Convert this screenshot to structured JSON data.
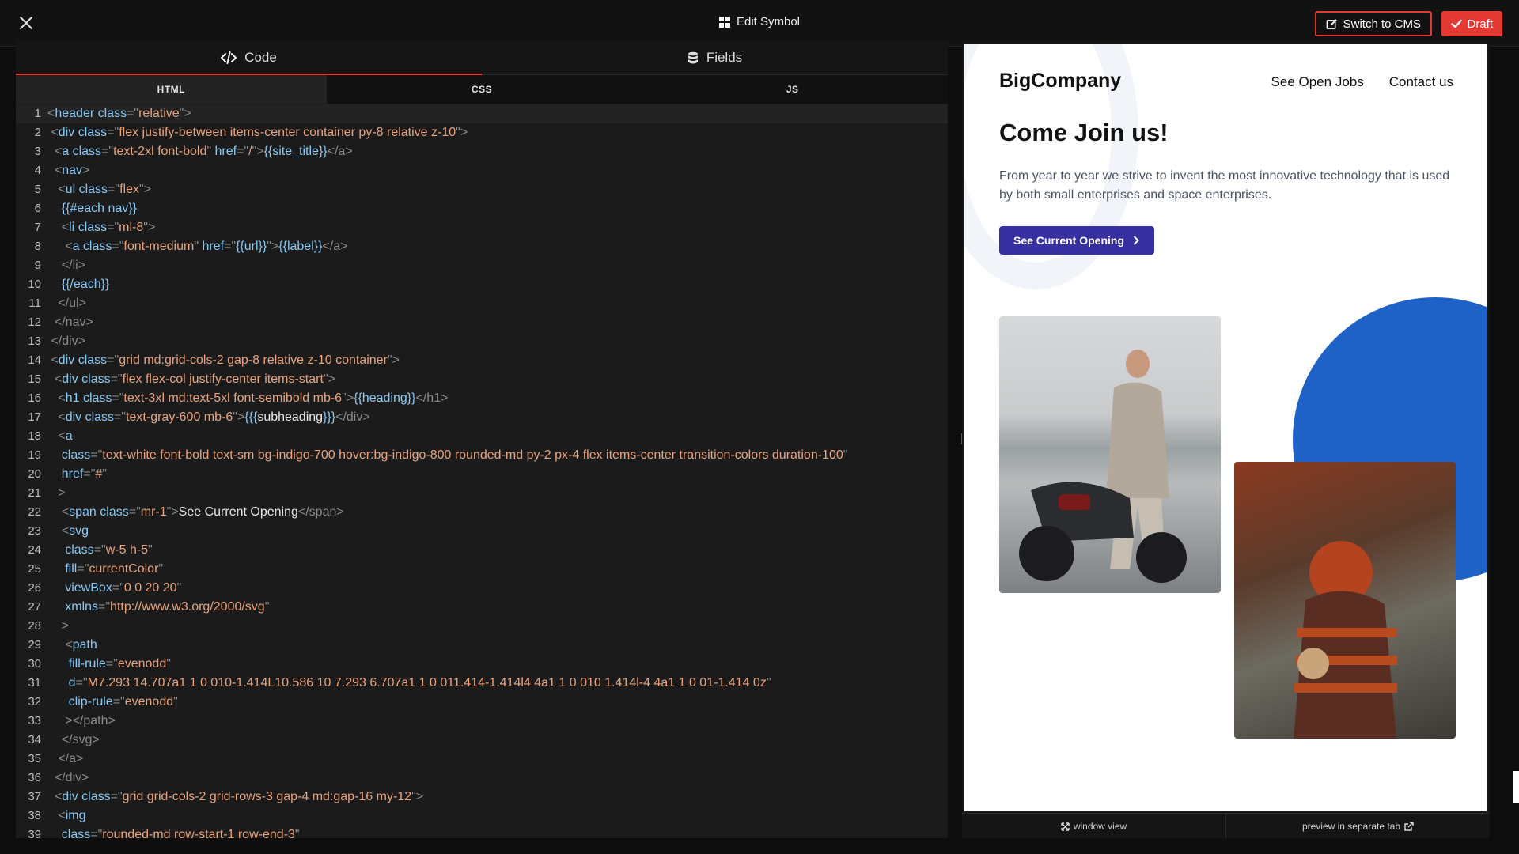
{
  "topbar": {
    "title": "Edit Symbol",
    "switch_label": "Switch to CMS",
    "draft_label": "Draft"
  },
  "editor": {
    "tabs": [
      {
        "label": "Code"
      },
      {
        "label": "Fields"
      }
    ],
    "subtabs": [
      {
        "label": "HTML"
      },
      {
        "label": "CSS"
      },
      {
        "label": "JS"
      }
    ],
    "lines": [
      [
        [
          "p",
          "<"
        ],
        [
          "t",
          "header "
        ],
        [
          "a",
          "class"
        ],
        [
          "p",
          "=\""
        ],
        [
          "s",
          "relative"
        ],
        [
          "p",
          "\">"
        ]
      ],
      [
        [
          "p",
          " <"
        ],
        [
          "t",
          "div "
        ],
        [
          "a",
          "class"
        ],
        [
          "p",
          "=\""
        ],
        [
          "s",
          "flex justify-between items-center container py-8 relative z-10"
        ],
        [
          "p",
          "\">"
        ]
      ],
      [
        [
          "p",
          "  <"
        ],
        [
          "t",
          "a "
        ],
        [
          "a",
          "class"
        ],
        [
          "p",
          "=\""
        ],
        [
          "s",
          "text-2xl font-bold"
        ],
        [
          "p",
          "\" "
        ],
        [
          "a",
          "href"
        ],
        [
          "p",
          "=\""
        ],
        [
          "s",
          "/"
        ],
        [
          "p",
          "\">"
        ],
        [
          "h",
          "{{site_title}}"
        ],
        [
          "p",
          "</a>"
        ]
      ],
      [
        [
          "p",
          "  <"
        ],
        [
          "t",
          "nav"
        ],
        [
          "p",
          ">"
        ]
      ],
      [
        [
          "p",
          "   <"
        ],
        [
          "t",
          "ul "
        ],
        [
          "a",
          "class"
        ],
        [
          "p",
          "=\""
        ],
        [
          "s",
          "flex"
        ],
        [
          "p",
          "\">"
        ]
      ],
      [
        [
          "h",
          "    {{#each nav}}"
        ]
      ],
      [
        [
          "p",
          "    <"
        ],
        [
          "t",
          "li "
        ],
        [
          "a",
          "class"
        ],
        [
          "p",
          "=\""
        ],
        [
          "s",
          "ml-8"
        ],
        [
          "p",
          "\">"
        ]
      ],
      [
        [
          "p",
          "     <"
        ],
        [
          "t",
          "a "
        ],
        [
          "a",
          "class"
        ],
        [
          "p",
          "=\""
        ],
        [
          "s",
          "font-medium"
        ],
        [
          "p",
          "\" "
        ],
        [
          "a",
          "href"
        ],
        [
          "p",
          "=\""
        ],
        [
          "h",
          "{{url}}"
        ],
        [
          "p",
          "\">"
        ],
        [
          "h",
          "{{label}}"
        ],
        [
          "p",
          "</a>"
        ]
      ],
      [
        [
          "p",
          "    </li>"
        ]
      ],
      [
        [
          "h",
          "    {{/each}}"
        ]
      ],
      [
        [
          "p",
          "   </ul>"
        ]
      ],
      [
        [
          "p",
          "  </nav>"
        ]
      ],
      [
        [
          "p",
          " </div>"
        ]
      ],
      [
        [
          "p",
          " <"
        ],
        [
          "t",
          "div "
        ],
        [
          "a",
          "class"
        ],
        [
          "p",
          "=\""
        ],
        [
          "s",
          "grid md:grid-cols-2 gap-8 relative z-10 container"
        ],
        [
          "p",
          "\">"
        ]
      ],
      [
        [
          "p",
          "  <"
        ],
        [
          "t",
          "div "
        ],
        [
          "a",
          "class"
        ],
        [
          "p",
          "=\""
        ],
        [
          "s",
          "flex flex-col justify-center items-start"
        ],
        [
          "p",
          "\">"
        ]
      ],
      [
        [
          "p",
          "   <"
        ],
        [
          "t",
          "h1 "
        ],
        [
          "a",
          "class"
        ],
        [
          "p",
          "=\""
        ],
        [
          "s",
          "text-3xl md:text-5xl font-semibold mb-6"
        ],
        [
          "p",
          "\">"
        ],
        [
          "h",
          "{{heading}}"
        ],
        [
          "p",
          "</h1>"
        ]
      ],
      [
        [
          "p",
          "   <"
        ],
        [
          "t",
          "div "
        ],
        [
          "a",
          "class"
        ],
        [
          "p",
          "=\""
        ],
        [
          "s",
          "text-gray-600 mb-6"
        ],
        [
          "p",
          "\">"
        ],
        [
          "h",
          "{{{"
        ],
        [
          "w",
          "subheading"
        ],
        [
          "h",
          "}}}"
        ],
        [
          "p",
          "</div>"
        ]
      ],
      [
        [
          "p",
          "   <"
        ],
        [
          "t",
          "a"
        ]
      ],
      [
        [
          "a",
          "    class"
        ],
        [
          "p",
          "=\""
        ],
        [
          "s",
          "text-white font-bold text-sm bg-indigo-700 hover:bg-indigo-800 rounded-md py-2 px-4 flex items-center transition-colors duration-100"
        ],
        [
          "p",
          "\""
        ]
      ],
      [
        [
          "a",
          "    href"
        ],
        [
          "p",
          "=\""
        ],
        [
          "s",
          "#"
        ],
        [
          "p",
          "\""
        ]
      ],
      [
        [
          "p",
          "   >"
        ]
      ],
      [
        [
          "p",
          "    <"
        ],
        [
          "t",
          "span "
        ],
        [
          "a",
          "class"
        ],
        [
          "p",
          "=\""
        ],
        [
          "s",
          "mr-1"
        ],
        [
          "p",
          "\">"
        ],
        [
          "w",
          "See Current Opening"
        ],
        [
          "p",
          "</span>"
        ]
      ],
      [
        [
          "p",
          "    <"
        ],
        [
          "t",
          "svg"
        ]
      ],
      [
        [
          "a",
          "     class"
        ],
        [
          "p",
          "=\""
        ],
        [
          "s",
          "w-5 h-5"
        ],
        [
          "p",
          "\""
        ]
      ],
      [
        [
          "a",
          "     fill"
        ],
        [
          "p",
          "=\""
        ],
        [
          "s",
          "currentColor"
        ],
        [
          "p",
          "\""
        ]
      ],
      [
        [
          "a",
          "     viewBox"
        ],
        [
          "p",
          "=\""
        ],
        [
          "s",
          "0 0 20 20"
        ],
        [
          "p",
          "\""
        ]
      ],
      [
        [
          "a",
          "     xmlns"
        ],
        [
          "p",
          "=\""
        ],
        [
          "s",
          "http://www.w3.org/2000/svg"
        ],
        [
          "p",
          "\""
        ]
      ],
      [
        [
          "p",
          "    >"
        ]
      ],
      [
        [
          "p",
          "     <"
        ],
        [
          "t",
          "path"
        ]
      ],
      [
        [
          "a",
          "      fill-rule"
        ],
        [
          "p",
          "=\""
        ],
        [
          "s",
          "evenodd"
        ],
        [
          "p",
          "\""
        ]
      ],
      [
        [
          "a",
          "      d"
        ],
        [
          "p",
          "=\""
        ],
        [
          "s",
          "M7.293 14.707a1 1 0 010-1.414L10.586 10 7.293 6.707a1 1 0 011.414-1.414l4 4a1 1 0 010 1.414l-4 4a1 1 0 01-1.414 0z"
        ],
        [
          "p",
          "\""
        ]
      ],
      [
        [
          "a",
          "      clip-rule"
        ],
        [
          "p",
          "=\""
        ],
        [
          "s",
          "evenodd"
        ],
        [
          "p",
          "\""
        ]
      ],
      [
        [
          "p",
          "     ></path>"
        ]
      ],
      [
        [
          "p",
          "    </svg>"
        ]
      ],
      [
        [
          "p",
          "   </a>"
        ]
      ],
      [
        [
          "p",
          "  </div>"
        ]
      ],
      [
        [
          "p",
          "  <"
        ],
        [
          "t",
          "div "
        ],
        [
          "a",
          "class"
        ],
        [
          "p",
          "=\""
        ],
        [
          "s",
          "grid grid-cols-2 grid-rows-3 gap-4 md:gap-16 my-12"
        ],
        [
          "p",
          "\">"
        ]
      ],
      [
        [
          "p",
          "   <"
        ],
        [
          "t",
          "img"
        ]
      ],
      [
        [
          "a",
          "    class"
        ],
        [
          "p",
          "=\""
        ],
        [
          "s",
          "rounded-md row-start-1 row-end-3"
        ],
        [
          "p",
          "\""
        ]
      ]
    ]
  },
  "preview": {
    "brand": "BigCompany",
    "nav": [
      "See Open Jobs",
      "Contact us"
    ],
    "heading": "Come Join us!",
    "subheading": "From year to year we strive to invent the most innovative technology that is used by both small enterprises and space enterprises.",
    "cta": "See Current Opening",
    "footer": {
      "window_view": "window view",
      "separate_tab": "preview in separate tab"
    }
  }
}
